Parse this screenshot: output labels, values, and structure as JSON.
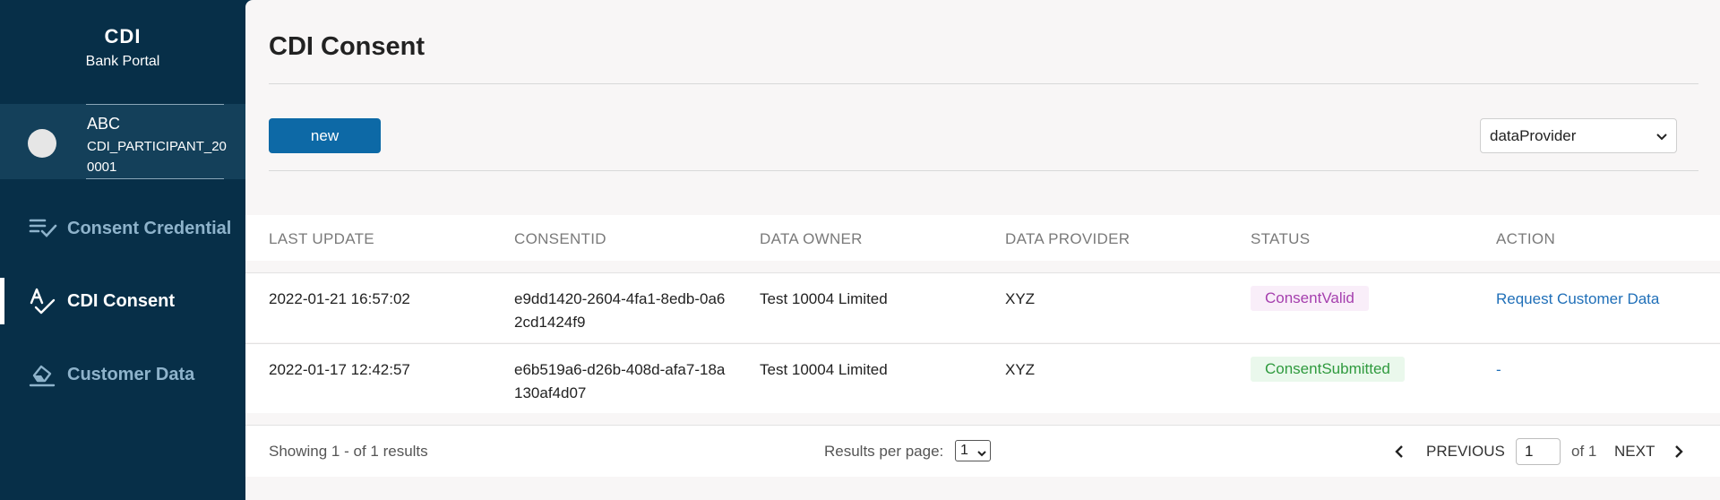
{
  "sidebar": {
    "brand_title": "CDI",
    "brand_subtitle": "Bank Portal",
    "user": {
      "name": "ABC",
      "participant_id": "CDI_PARTICIPANT_200001"
    },
    "nav": [
      {
        "label": "Consent Credential",
        "icon": "list-check-icon",
        "active": false
      },
      {
        "label": "CDI Consent",
        "icon": "text-check-icon",
        "active": true
      },
      {
        "label": "Customer Data",
        "icon": "eraser-icon",
        "active": false
      }
    ]
  },
  "main": {
    "title": "CDI Consent",
    "new_button": "new",
    "provider_select": "dataProvider",
    "table": {
      "headers": [
        "LAST UPDATE",
        "CONSENTID",
        "DATA OWNER",
        "DATA PROVIDER",
        "STATUS",
        "ACTION"
      ],
      "rows": [
        {
          "last_update": "2022-01-21 16:57:02",
          "consent_id": "e9dd1420-2604-4fa1-8edb-0a62cd1424f9",
          "data_owner": "Test 10004 Limited",
          "data_provider": "XYZ",
          "status": "ConsentValid",
          "action": "Request Customer Data"
        },
        {
          "last_update": "2022-01-17 12:42:57",
          "consent_id": "e6b519a6-d26b-408d-afa7-18a130af4d07",
          "data_owner": "Test 10004 Limited",
          "data_provider": "XYZ",
          "status": "ConsentSubmitted",
          "action": "-"
        }
      ]
    },
    "footer": {
      "showing": "Showing 1 - of 1 results",
      "results_per_page_label": "Results per page:",
      "results_per_page_value": "1",
      "previous_label": "PREVIOUS",
      "page_value": "1",
      "of_label": "of 1",
      "next_label": "NEXT"
    }
  },
  "colors": {
    "sidebar_bg": "#072f48",
    "primary_button": "#0d69a6",
    "link": "#1f6fb8",
    "status_valid": "#a53fae",
    "status_submitted": "#2f9a3e"
  }
}
